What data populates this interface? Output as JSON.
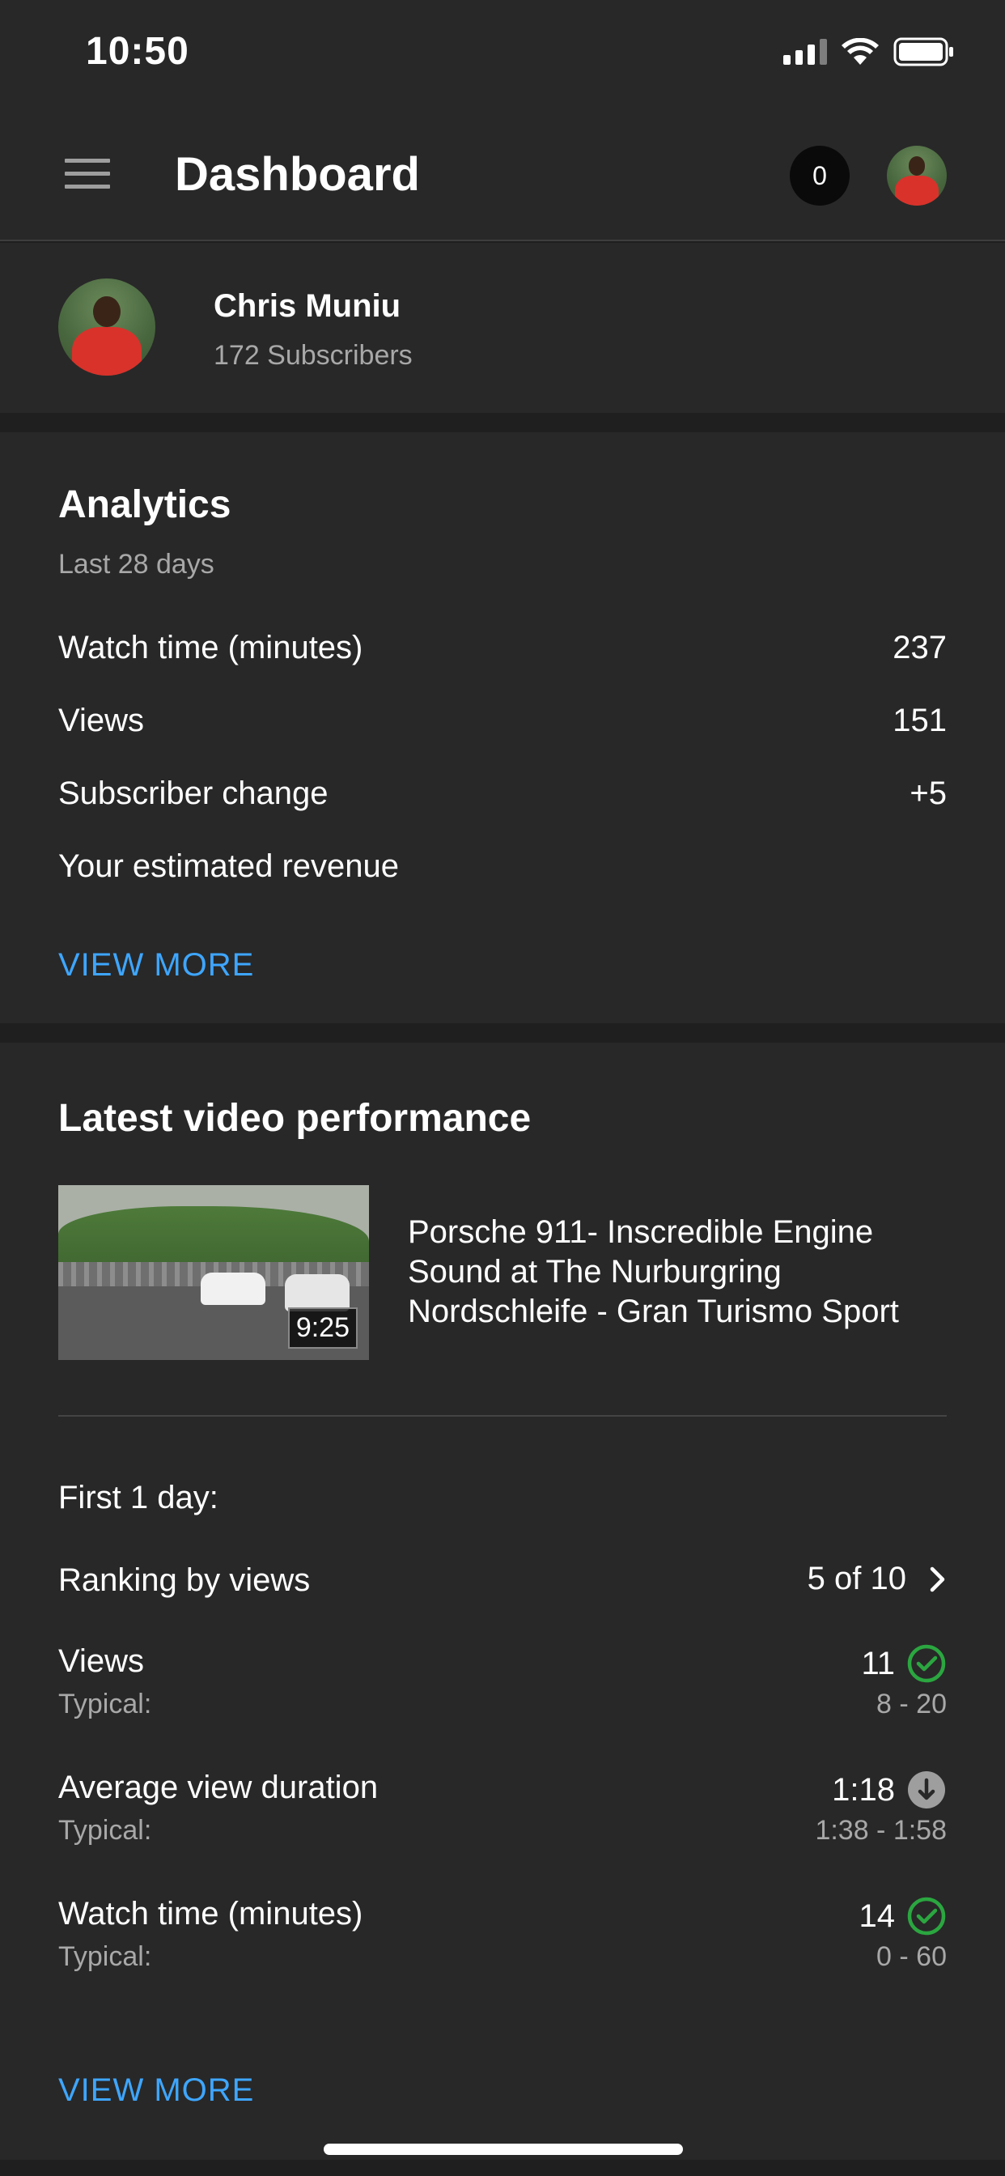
{
  "status_bar": {
    "time": "10:50"
  },
  "app_bar": {
    "title": "Dashboard",
    "notification_count": "0"
  },
  "channel": {
    "name": "Chris Muniu",
    "subscribers": "172 Subscribers"
  },
  "analytics": {
    "title": "Analytics",
    "period": "Last 28 days",
    "rows": [
      {
        "label": "Watch time (minutes)",
        "value": "237"
      },
      {
        "label": "Views",
        "value": "151"
      },
      {
        "label": "Subscriber change",
        "value": "+5"
      },
      {
        "label": "Your estimated revenue",
        "value": ""
      }
    ],
    "view_more": "VIEW MORE"
  },
  "latest_video": {
    "title": "Latest video performance",
    "video_title": "Porsche 911- Inscredible Engine Sound at The Nurburgring Nordschleife - Gran Turismo Sport",
    "duration": "9:25",
    "period_label": "First 1 day:",
    "ranking": {
      "label": "Ranking by views",
      "value": "5 of 10"
    },
    "metrics": [
      {
        "label": "Views",
        "typical_label": "Typical:",
        "value": "11",
        "typical": "8 - 20",
        "status": "check",
        "status_color": "#2ba640"
      },
      {
        "label": "Average view duration",
        "typical_label": "Typical:",
        "value": "1:18",
        "typical": "1:38 - 1:58",
        "status": "down",
        "status_color": "#9e9e9e"
      },
      {
        "label": "Watch time (minutes)",
        "typical_label": "Typical:",
        "value": "14",
        "typical": "0 - 60",
        "status": "check",
        "status_color": "#2ba640"
      }
    ],
    "view_more": "VIEW MORE"
  },
  "colors": {
    "accent": "#3ea6ff",
    "background": "#1f1f1f",
    "card": "#282828"
  }
}
